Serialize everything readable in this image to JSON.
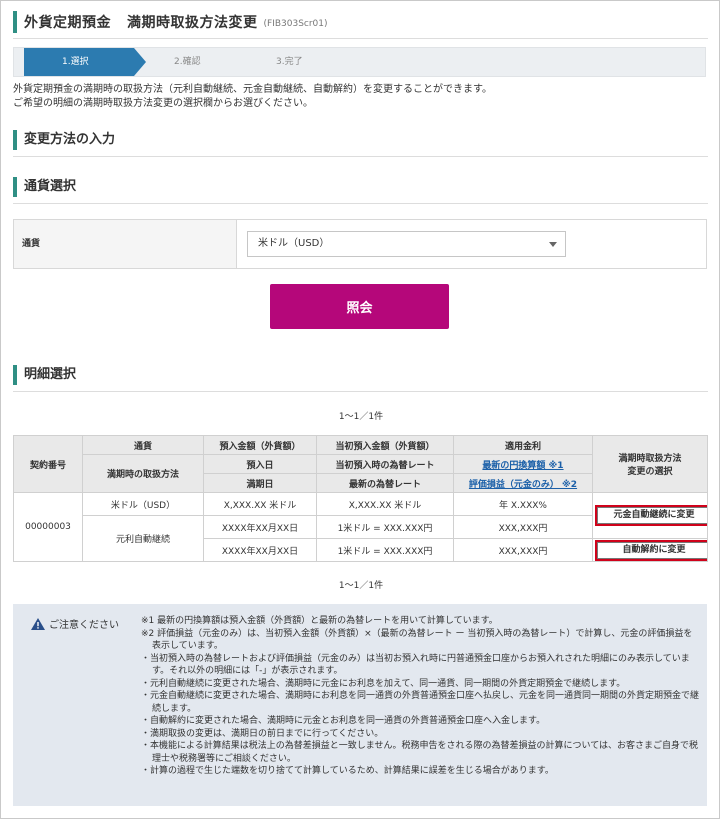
{
  "header": {
    "title": "外貨定期預金",
    "subtitle": "満期時取扱方法変更",
    "screen_code": "(FIB303Scr01)"
  },
  "steps": [
    {
      "label": "1.選択",
      "active": true
    },
    {
      "label": "2.確認",
      "active": false
    },
    {
      "label": "3.完了",
      "active": false
    }
  ],
  "intro": [
    "外貨定期預金の満期時の取扱方法（元利自動継続、元金自動継続、自動解約）を変更することができます。",
    "ご希望の明細の満期時取扱方法変更の選択欄からお選びください。"
  ],
  "sections": {
    "change_method": "変更方法の入力",
    "currency_select": "通貨選択",
    "detail_select": "明細選択"
  },
  "currency": {
    "label": "通貨",
    "selected": "米ドル（USD）"
  },
  "query_button": "照会",
  "pagination": "1～1／1件",
  "table": {
    "headers": {
      "contract_no": "契約番号",
      "currency": "通貨",
      "handling": "満期時の取扱方法",
      "deposit_amount": "預入金額（外貨額）",
      "deposit_date": "預入日",
      "maturity_date": "満期日",
      "initial_amount": "当初預入金額（外貨額）",
      "initial_rate": "当初預入時の為替レート",
      "latest_rate": "最新の為替レート",
      "applied_rate": "適用金利",
      "latest_yen": "最新の円換算額 ※1",
      "valuation": "評価損益（元金のみ） ※2",
      "change_select_1": "満期時取扱方法",
      "change_select_2": "変更の選択"
    },
    "rows": [
      {
        "contract_no": "00000003",
        "currency": "米ドル（USD）",
        "handling": "元利自動継続",
        "deposit_amount": "X,XXX.XX 米ドル",
        "deposit_date": "XXXX年XX月XX日",
        "maturity_date": "XXXX年XX月XX日",
        "initial_amount": "X,XXX.XX 米ドル",
        "initial_rate": "1米ドル = XXX.XXX円",
        "latest_rate": "1米ドル = XXX.XXX円",
        "applied_rate": "年 X.XXX%",
        "latest_yen": "XXX,XXX円",
        "valuation": "XXX,XXX円",
        "btn_principal": "元金自動継続に変更",
        "btn_cancel": "自動解約に変更"
      }
    ]
  },
  "notes": {
    "label": "ご注意ください",
    "items": [
      "※1 最新の円換算額は預入金額（外貨額）と最新の為替レートを用いて計算しています。",
      "※2 評価損益（元金のみ）は、当初預入金額（外貨額）×（最新の為替レート ー 当初預入時の為替レート）で計算し、元金の評価損益を表示しています。",
      "・当初預入時の為替レートおよび評価損益（元金のみ）は当初お預入れ時に円普通預金口座からお預入れされた明細にのみ表示しています。それ以外の明細には「-」が表示されます。",
      "・元利自動継続に変更された場合、満期時に元金にお利息を加えて、同一通貨、同一期間の外貨定期預金で継続します。",
      "・元金自動継続に変更された場合、満期時にお利息を同一通貨の外貨普通預金口座へ払戻し、元金を同一通貨同一期間の外貨定期預金で継続します。",
      "・自動解約に変更された場合、満期時に元金とお利息を同一通貨の外貨普通預金口座へ入金します。",
      "・満期取扱の変更は、満期日の前日までに行ってください。",
      "・本機能による計算結果は税法上の為替差損益と一致しません。税務申告をされる際の為替差損益の計算については、お客さまご自身で税理士や税務署等にご相談ください。",
      "・計算の過程で生じた端数を切り捨てて計算しているため、計算結果に誤差を生じる場合があります。"
    ]
  },
  "colors": {
    "accent_bar": "#2f8f84",
    "step_active": "#2c7bb0",
    "query_button": "#b5077a",
    "action_highlight": "#d0021b",
    "link": "#1a5fa8"
  }
}
